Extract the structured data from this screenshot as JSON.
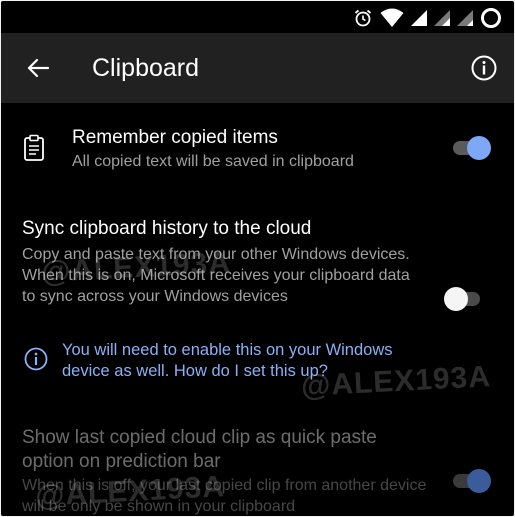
{
  "status_bar": {
    "icons": [
      "alarm-icon",
      "wifi-icon",
      "signal-icon",
      "signal-icon",
      "signal-icon",
      "battery-ring-icon"
    ]
  },
  "app_bar": {
    "title": "Clipboard",
    "back_icon": "arrow-left-icon",
    "info_icon": "info-circle-icon"
  },
  "settings": {
    "remember": {
      "icon": "clipboard-icon",
      "title": "Remember copied items",
      "subtitle": "All copied text will be saved in clipboard",
      "toggle_on": true
    },
    "sync": {
      "title": "Sync clipboard history to the cloud",
      "description": "Copy and paste text from your other Windows devices. When this is on, Microsoft receives your clipboard data to sync across your Windows devices",
      "toggle_on": false,
      "notice": "You will need to enable this on your Windows device as well. How do I set this up?",
      "notice_icon": "info-circle-icon"
    },
    "quick_paste": {
      "title": "Show last copied cloud clip as quick paste option on prediction bar",
      "description": "When this is off, your last copied clip from another device will be only be shown in your clipboard",
      "toggle_on": true,
      "enabled": false
    }
  },
  "watermark": "@ALEX193A",
  "colors": {
    "background": "#000000",
    "app_bar": "#212121",
    "accent": "#7ea7f8",
    "link": "#8ab0f5",
    "secondary_text": "#a0a0a0"
  }
}
